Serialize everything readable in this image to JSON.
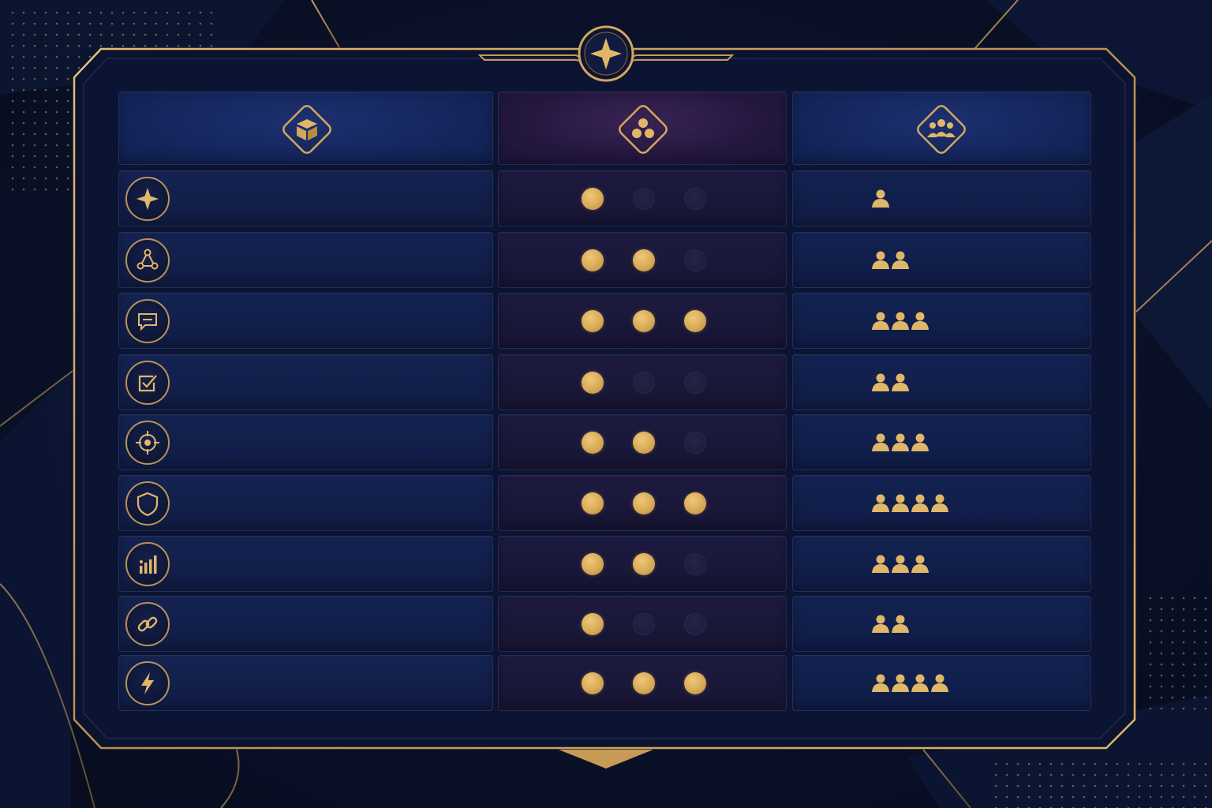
{
  "colors": {
    "gold": "#d7aa58",
    "gold_dark": "#b8925a",
    "background": "#0a1128",
    "cell_blue": "#122150",
    "cell_purple": "#1b1839",
    "dot_off": "#1f1f40"
  },
  "header": {
    "emblem_icon": "four-point-star-icon",
    "columns": [
      {
        "icon": "cube-icon"
      },
      {
        "icon": "three-circles-icon"
      },
      {
        "icon": "group-icon"
      }
    ]
  },
  "rows": [
    {
      "icon": "sparkle-icon",
      "level": 1,
      "level_max": 3,
      "people": 1
    },
    {
      "icon": "network-icon",
      "level": 2,
      "level_max": 3,
      "people": 2
    },
    {
      "icon": "chat-icon",
      "level": 3,
      "level_max": 3,
      "people": 3
    },
    {
      "icon": "checkbox-icon",
      "level": 1,
      "level_max": 3,
      "people": 2
    },
    {
      "icon": "target-icon",
      "level": 2,
      "level_max": 3,
      "people": 3
    },
    {
      "icon": "shield-icon",
      "level": 3,
      "level_max": 3,
      "people": 4
    },
    {
      "icon": "bar-chart-icon",
      "level": 2,
      "level_max": 3,
      "people": 3
    },
    {
      "icon": "link-icon",
      "level": 1,
      "level_max": 3,
      "people": 2
    },
    {
      "icon": "lightning-icon",
      "level": 3,
      "level_max": 3,
      "people": 4
    }
  ]
}
